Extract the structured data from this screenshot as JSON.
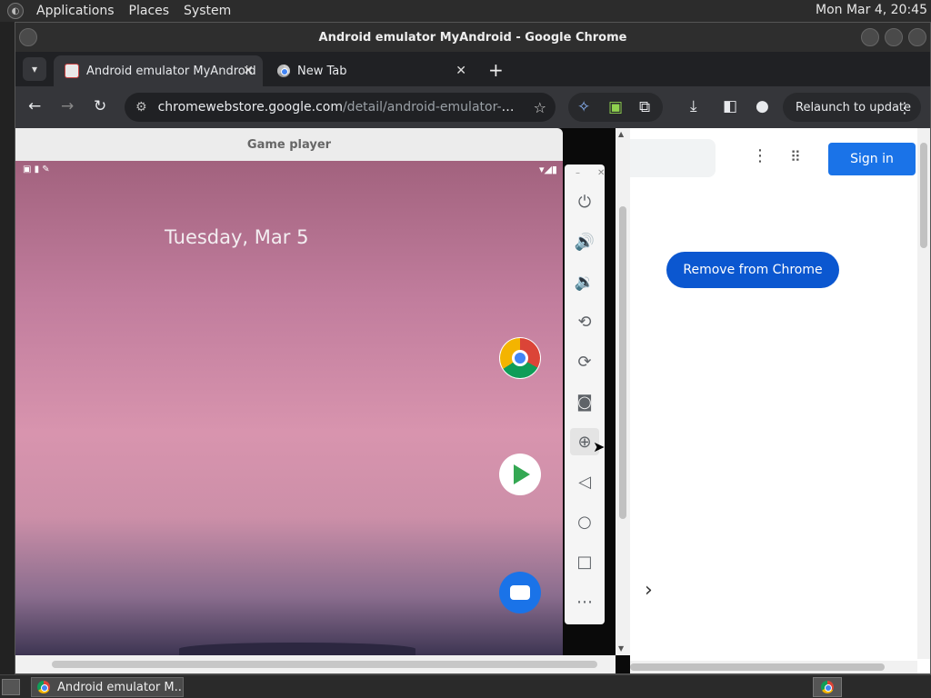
{
  "system": {
    "menus": [
      "Applications",
      "Places",
      "System"
    ],
    "clock": "Mon Mar  4, 20:45"
  },
  "window": {
    "title": "Android emulator MyAndroid - Google Chrome"
  },
  "tabs": [
    {
      "label": "Android emulator MyAndroid",
      "active": true,
      "icon": "emulator-favicon"
    },
    {
      "label": "New Tab",
      "active": false,
      "icon": "chrome-favicon"
    }
  ],
  "toolbar": {
    "url_host": "chromewebstore.google.com",
    "url_path": "/detail/android-emulator-myand...",
    "relaunch_label": "Relaunch to update"
  },
  "emulator": {
    "title": "Game player",
    "date": "Tuesday, Mar 5",
    "apps": [
      "Chrome",
      "Play Store",
      "Messages"
    ],
    "controls": [
      "power",
      "volume-up",
      "volume-down",
      "rotate-left",
      "rotate-right",
      "screenshot",
      "zoom",
      "back",
      "home",
      "overview",
      "more"
    ]
  },
  "store": {
    "signin_label": "Sign in",
    "remove_label": "Remove from Chrome"
  },
  "taskbar": {
    "task_label": "Android emulator M..."
  },
  "colors": {
    "signin": "#1a73e8",
    "remove": "#0b57d0",
    "chrome_dark": "#35363a"
  }
}
